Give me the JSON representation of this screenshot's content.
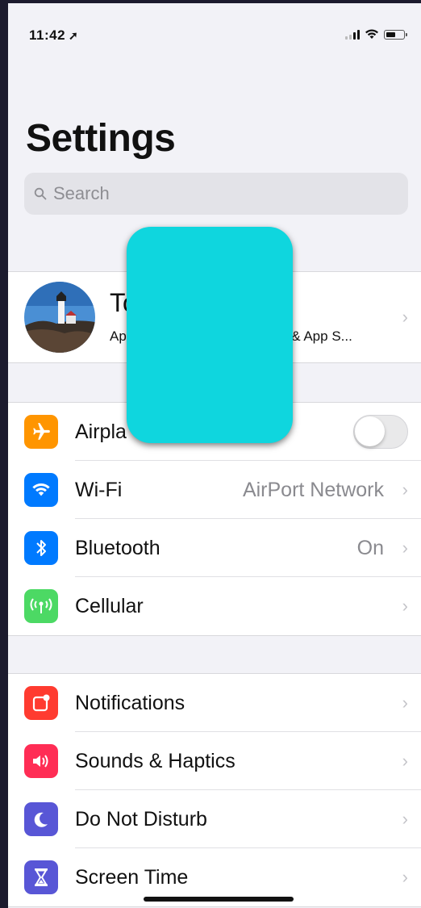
{
  "status_bar": {
    "time": "11:42",
    "location_glyph": "➚"
  },
  "header": {
    "title": "Settings"
  },
  "search": {
    "placeholder": "Search"
  },
  "profile": {
    "name_visible": "To",
    "subtitle_left": "App",
    "subtitle_right": "s & App S..."
  },
  "sections": {
    "connectivity": [
      {
        "label": "Airpla",
        "icon": "airplane-icon",
        "color": "#ff9500",
        "toggle": false
      },
      {
        "label": "Wi-Fi",
        "icon": "wifi-icon",
        "color": "#007aff",
        "value": "AirPort Network"
      },
      {
        "label": "Bluetooth",
        "icon": "bluetooth-icon",
        "color": "#007aff",
        "value": "On"
      },
      {
        "label": "Cellular",
        "icon": "cellular-icon",
        "color": "#4cd964"
      }
    ],
    "notifications": [
      {
        "label": "Notifications",
        "icon": "notifications-icon",
        "color": "#ff3b30"
      },
      {
        "label": "Sounds & Haptics",
        "icon": "sounds-icon",
        "color": "#ff2d55"
      },
      {
        "label": "Do Not Disturb",
        "icon": "moon-icon",
        "color": "#5856d6"
      },
      {
        "label": "Screen Time",
        "icon": "hourglass-icon",
        "color": "#5856d6"
      }
    ]
  },
  "chevron": "›",
  "overlay_color": "#0fd6de"
}
